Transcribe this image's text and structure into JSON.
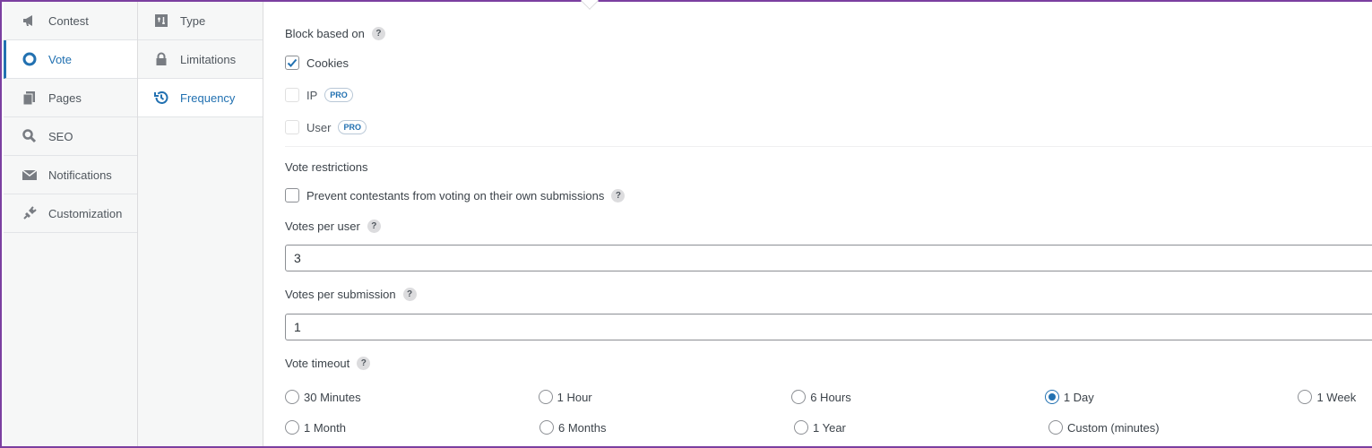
{
  "nav_primary": [
    {
      "label": "Contest",
      "icon": "megaphone-icon",
      "active": false
    },
    {
      "label": "Vote",
      "icon": "circle-icon",
      "active": true
    },
    {
      "label": "Pages",
      "icon": "pages-icon",
      "active": false
    },
    {
      "label": "SEO",
      "icon": "search-icon",
      "active": false
    },
    {
      "label": "Notifications",
      "icon": "envelope-icon",
      "active": false
    },
    {
      "label": "Customization",
      "icon": "plugin-icon",
      "active": false
    }
  ],
  "nav_secondary": [
    {
      "label": "Type",
      "icon": "type-icon",
      "active": false
    },
    {
      "label": "Limitations",
      "icon": "lock-icon",
      "active": false
    },
    {
      "label": "Frequency",
      "icon": "history-icon",
      "active": true
    }
  ],
  "block": {
    "title": "Block based on",
    "options": [
      {
        "label": "Cookies",
        "checked": true,
        "pro": false
      },
      {
        "label": "IP",
        "checked": false,
        "pro": true
      },
      {
        "label": "User",
        "checked": false,
        "pro": true
      }
    ],
    "pro_badge": "PRO"
  },
  "restrictions": {
    "title": "Vote restrictions",
    "prevent_label": "Prevent contestants from voting on their own submissions",
    "prevent_checked": false
  },
  "votes_per_user": {
    "label": "Votes per user",
    "value": "3"
  },
  "votes_per_submission": {
    "label": "Votes per submission",
    "value": "1"
  },
  "timeout": {
    "label": "Vote timeout",
    "options_row1": [
      {
        "label": "30 Minutes",
        "selected": false
      },
      {
        "label": "1 Hour",
        "selected": false
      },
      {
        "label": "6 Hours",
        "selected": false
      },
      {
        "label": "1 Day",
        "selected": true
      },
      {
        "label": "1 Week",
        "selected": false
      }
    ],
    "options_row2": [
      {
        "label": "1 Month",
        "selected": false
      },
      {
        "label": "6 Months",
        "selected": false
      },
      {
        "label": "1 Year",
        "selected": false
      },
      {
        "label": "Custom (minutes)",
        "selected": false
      }
    ]
  },
  "help_symbol": "?",
  "colors": {
    "accent": "#2271b1",
    "frame": "#7b3fa0"
  }
}
